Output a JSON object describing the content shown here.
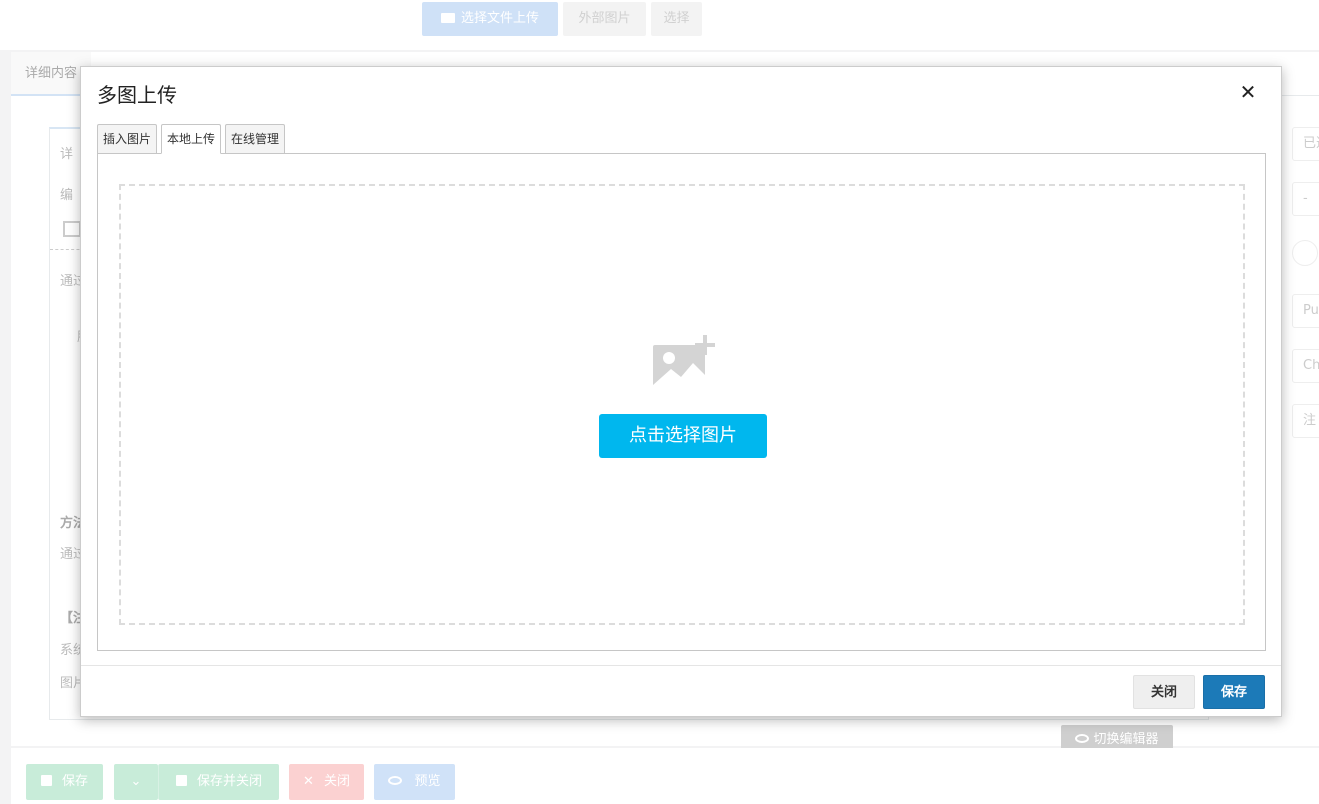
{
  "background": {
    "top_buttons": {
      "upload_label": "选择文件上传",
      "external_label": "外部图片",
      "select_label": "选择"
    },
    "tab_detail_label": "详细内容",
    "inner": {
      "tab_label": "详",
      "edit_label": "编",
      "pass_text_1": "通过",
      "center_char": "服",
      "method_label": "方法",
      "pass_text_2": "通过",
      "note_label": "【注",
      "system_label": "系统",
      "image_label": "图片"
    },
    "right_fields": {
      "f1": "已选",
      "f2": "-",
      "f3": "Pu",
      "f4": "Ch",
      "f5": "注"
    },
    "switch_editor_label": "切换编辑器",
    "footer": {
      "save_label": "保存",
      "save_close_label": "保存并关闭",
      "close_label": "关闭",
      "preview_label": "预览"
    }
  },
  "dialog": {
    "title": "多图上传",
    "close_glyph": "✕",
    "tabs": [
      {
        "label": "插入图片"
      },
      {
        "label": "本地上传"
      },
      {
        "label": "在线管理"
      }
    ],
    "active_tab": "本地上传",
    "pick_button_label": "点击选择图片",
    "footer": {
      "close_label": "关闭",
      "save_label": "保存"
    }
  },
  "colors": {
    "pick_button": "#00b7ee",
    "save_button": "#1c7ab8"
  },
  "icons": {
    "placeholder": "image-add-icon",
    "close": "close-icon"
  }
}
